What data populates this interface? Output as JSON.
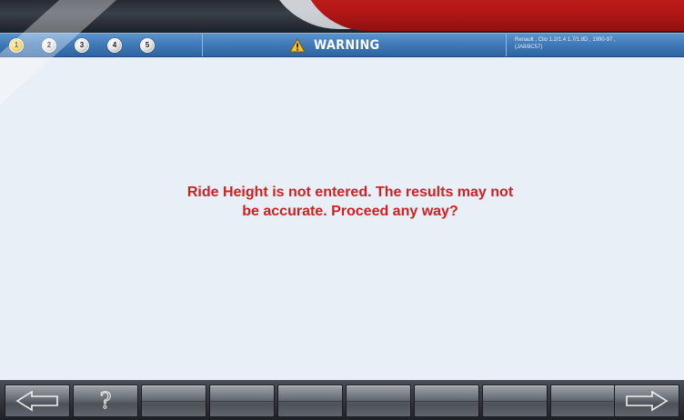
{
  "header": {
    "steps": [
      {
        "label": "1",
        "active": true
      },
      {
        "label": "2",
        "active": false
      },
      {
        "label": "3",
        "active": false
      },
      {
        "label": "4",
        "active": false
      },
      {
        "label": "5",
        "active": false
      }
    ],
    "title": "WARNING",
    "vehicle_line1": "Renault , Clio 1.2/1.4 1.7/1.8D , 1990-97 ,",
    "vehicle_line2": "(JA8/8C57)"
  },
  "main": {
    "message_line1": "Ride Height is not entered. The results may not",
    "message_line2": "be accurate. Proceed any way?"
  },
  "toolbar": {
    "buttons": [
      {
        "icon": "arrow-left-icon"
      },
      {
        "icon": "help-icon",
        "label": "?"
      },
      {
        "icon": ""
      },
      {
        "icon": ""
      },
      {
        "icon": ""
      },
      {
        "icon": ""
      },
      {
        "icon": ""
      },
      {
        "icon": ""
      },
      {
        "icon": ""
      },
      {
        "icon": "arrow-right-icon"
      }
    ]
  },
  "colors": {
    "accent_red": "#d21f1f",
    "header_blue": "#3f78b6",
    "step_active": "#f2c230"
  }
}
